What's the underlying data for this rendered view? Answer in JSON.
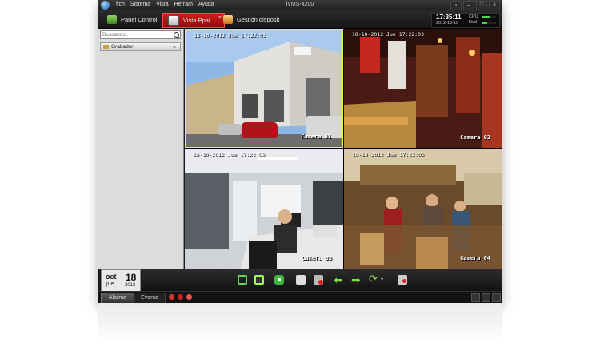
{
  "menu": [
    "fich",
    "Sistema",
    "Vista",
    "Herram",
    "Ayuda"
  ],
  "window_title": "iVMS-4200",
  "tabs": [
    {
      "label": "Panel Control",
      "active": false
    },
    {
      "label": "Vista Ppal",
      "active": true
    },
    {
      "label": "Gestión disposit",
      "active": false
    }
  ],
  "clock": {
    "time": "17:35:11",
    "date": "2012-10-18",
    "cpu_label": "CPU",
    "red_label": "Red",
    "cpu_level": 0.55,
    "red_level": 0.4
  },
  "sidebar": {
    "search_placeholder": "Buscando..",
    "group_label": "Grabador"
  },
  "cameras": [
    {
      "name": "Camera 01",
      "osd": "18-10-2012 Jue 17:22:03"
    },
    {
      "name": "Camera 02",
      "osd": "18-10-2012 Jue 17:22:03"
    },
    {
      "name": "Camera 03",
      "osd": "18-10-2012 Jue 17:22:03"
    },
    {
      "name": "Camera 04",
      "osd": "18-10-2012 Jue 17:22:03"
    }
  ],
  "calendar": {
    "month": "oct",
    "day": "18",
    "weekday": "jue",
    "year": "2012"
  },
  "bottom_tabs": [
    "Alarma",
    "Evento"
  ],
  "accent": "#c81414"
}
